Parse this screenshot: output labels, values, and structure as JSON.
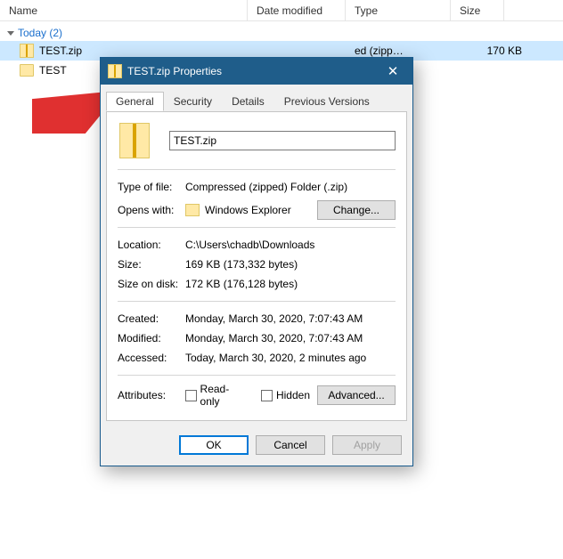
{
  "columns": {
    "name": "Name",
    "date": "Date modified",
    "type": "Type",
    "size": "Size"
  },
  "group": {
    "label": "Today (2)"
  },
  "files": [
    {
      "name": "TEST.zip",
      "type": "ed (zipp…",
      "size": "170 KB"
    },
    {
      "name": "TEST"
    }
  ],
  "dialog": {
    "title": "TEST.zip Properties",
    "tabs": {
      "general": "General",
      "security": "Security",
      "details": "Details",
      "previous": "Previous Versions"
    },
    "filename": "TEST.zip",
    "typeOfFile": {
      "label": "Type of file:",
      "value": "Compressed (zipped) Folder (.zip)"
    },
    "opensWith": {
      "label": "Opens with:",
      "value": "Windows Explorer",
      "changeBtn": "Change..."
    },
    "location": {
      "label": "Location:",
      "value": "C:\\Users\\chadb\\Downloads"
    },
    "size": {
      "label": "Size:",
      "value": "169 KB (173,332 bytes)"
    },
    "sizeOnDisk": {
      "label": "Size on disk:",
      "value": "172 KB (176,128 bytes)"
    },
    "created": {
      "label": "Created:",
      "value": "Monday, March 30, 2020, 7:07:43 AM"
    },
    "modified": {
      "label": "Modified:",
      "value": "Monday, March 30, 2020, 7:07:43 AM"
    },
    "accessed": {
      "label": "Accessed:",
      "value": "Today, March 30, 2020, 2 minutes ago"
    },
    "attributes": {
      "label": "Attributes:",
      "readonly": "Read-only",
      "hidden": "Hidden",
      "advancedBtn": "Advanced..."
    },
    "buttons": {
      "ok": "OK",
      "cancel": "Cancel",
      "apply": "Apply"
    }
  }
}
